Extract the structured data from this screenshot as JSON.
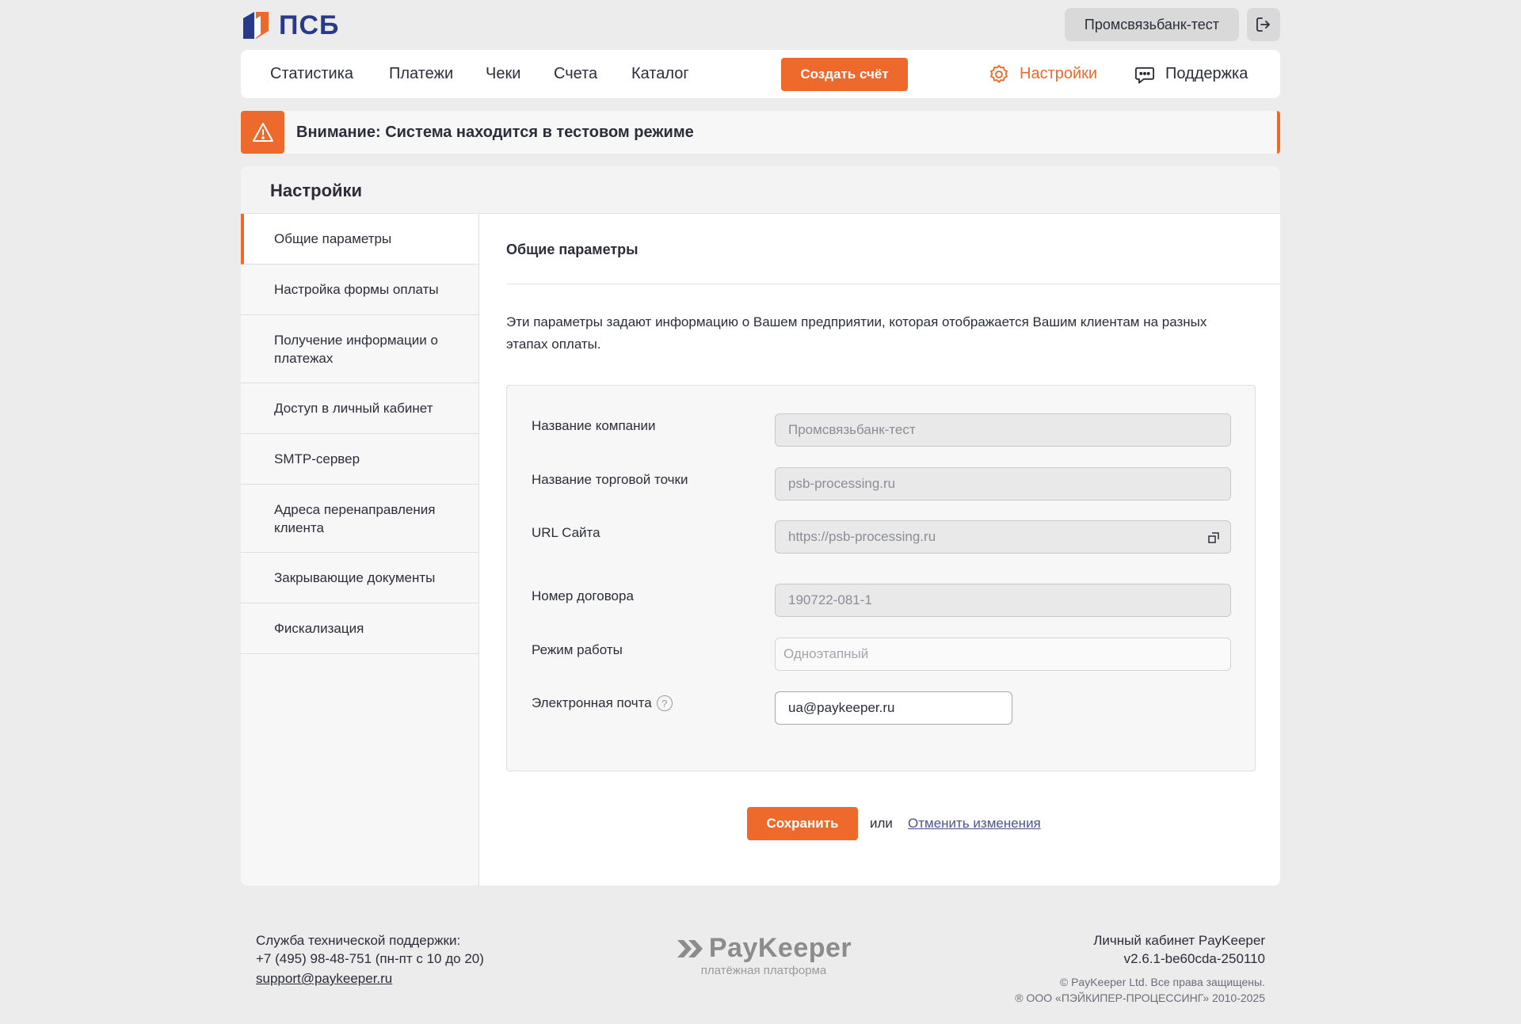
{
  "header": {
    "logo_text": "ПСБ",
    "account_label": "Промсвязьбанк-тест"
  },
  "nav": {
    "items": [
      "Статистика",
      "Платежи",
      "Чеки",
      "Счета",
      "Каталог"
    ],
    "create_label": "Создать счёт",
    "settings_label": "Настройки",
    "support_label": "Поддержка"
  },
  "alert": {
    "text": "Внимание: Система находится в тестовом режиме"
  },
  "panel": {
    "title": "Настройки",
    "sidebar": [
      "Общие параметры",
      "Настройка формы оплаты",
      "Получение информации о платежах",
      "Доступ в личный кабинет",
      "SMTP-сервер",
      "Адреса перенаправления клиента",
      "Закрывающие документы",
      "Фискализация"
    ],
    "active_index": 0
  },
  "content": {
    "title": "Общие параметры",
    "description": "Эти параметры задают информацию о Вашем предприятии, которая отображается Вашим клиентам на разных этапах оплаты.",
    "fields": {
      "company_label": "Название компании",
      "company_value": "Промсвязьбанк-тест",
      "shop_label": "Название торговой точки",
      "shop_value": "psb-processing.ru",
      "url_label": "URL Сайта",
      "url_value": "https://psb-processing.ru",
      "contract_label": "Номер договора",
      "contract_value": "190722-081-1",
      "mode_label": "Режим работы",
      "mode_placeholder": "Одноэтапный",
      "email_label": "Электронная почта",
      "email_value": "ua@paykeeper.ru"
    },
    "save_label": "Сохранить",
    "or_text": "или",
    "cancel_label": "Отменить изменения"
  },
  "footer": {
    "support_title": "Служба технической поддержки:",
    "support_phone": "+7 (495) 98-48-751 (пн-пт с 10 до 20)",
    "support_email": "support@paykeeper.ru",
    "brand": "PayKeeper",
    "brand_sub": "платёжная платформа",
    "cabinet_label": "Личный кабинет PayKeeper",
    "version": "v2.6.1-be60cda-250110",
    "rights": "© PayKeeper Ltd. Все права защищены.",
    "company": "® ООО «ПЭЙКИПЕР-ПРОЦЕССИНГ» 2010-2025"
  },
  "colors": {
    "accent": "#ee6a2c",
    "brand_blue": "#2a3a8a"
  }
}
